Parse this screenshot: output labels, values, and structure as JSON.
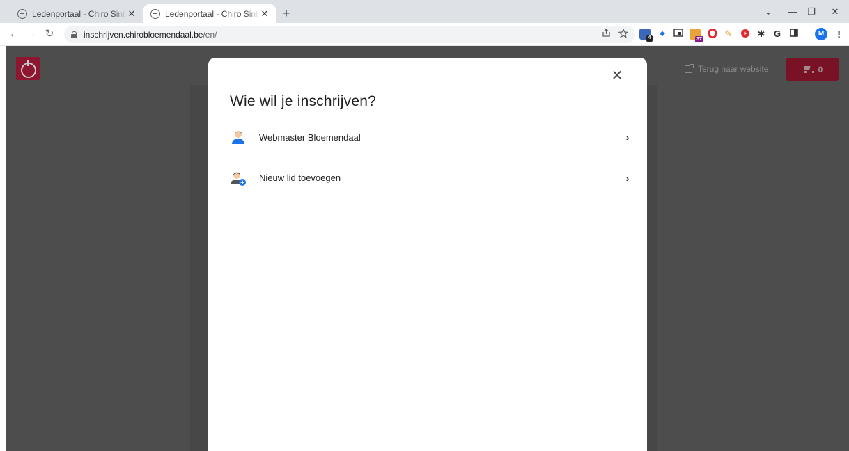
{
  "browser": {
    "tabs": [
      {
        "title": "Ledenportaal - Chiro Sint-Jozef B",
        "active": false
      },
      {
        "title": "Ledenportaal - Chiro Sint-Jozef B",
        "active": true
      }
    ],
    "new_tab_label": "+",
    "close_tab_glyph": "✕",
    "window_controls": {
      "menu": "⌄",
      "minimize": "—",
      "restore": "❐",
      "close": "✕"
    },
    "nav": {
      "back": "←",
      "forward": "→",
      "reload": "↻"
    },
    "url_host": "inschrijven.chirobloemendaal.be",
    "url_path": "/en/",
    "extension_badge_1": "4",
    "extension_badge_2": "37",
    "profile_initial": "M",
    "toolbar_icons": [
      "share-icon",
      "star-icon",
      "extension-icons",
      "puzzle-icon",
      "sidepanel-icon",
      "kebab-menu-icon"
    ]
  },
  "site": {
    "website_link_label": "Terug naar website",
    "cart_count": "0",
    "accent_color": "#8e1630"
  },
  "modal": {
    "title": "Wie wil je inschrijven?",
    "close_glyph": "✕",
    "options": [
      {
        "label": "Webmaster Bloemendaal",
        "icon": "user-avatar-icon",
        "chevron": "›"
      },
      {
        "label": "Nieuw lid toevoegen",
        "icon": "add-user-icon",
        "chevron": "›"
      }
    ]
  }
}
